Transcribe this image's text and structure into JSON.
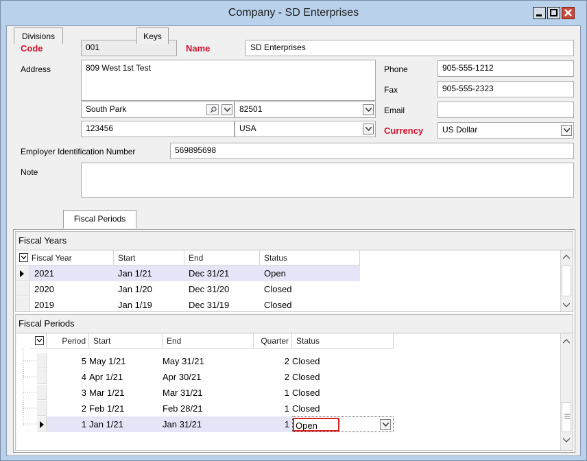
{
  "window": {
    "title": "Company - SD Enterprises"
  },
  "form": {
    "code_label": "Code",
    "code_value": "001",
    "name_label": "Name",
    "name_value": "SD Enterprises",
    "address_label": "Address",
    "address_value": "809 West 1st Test",
    "city_value": "South Park",
    "postal_value": "82501",
    "zip_value": "123456",
    "country_value": "USA",
    "phone_label": "Phone",
    "phone_value": "905-555-1212",
    "fax_label": "Fax",
    "fax_value": "905-555-2323",
    "email_label": "Email",
    "email_value": "",
    "currency_label": "Currency",
    "currency_value": "US Dollar",
    "ein_label": "Employer Identification Number",
    "ein_value": "569895698",
    "note_label": "Note",
    "note_value": ""
  },
  "tabs": [
    {
      "label": "Divisions"
    },
    {
      "label": "Fiscal Periods",
      "active": true
    },
    {
      "label": "Keys"
    }
  ],
  "fiscal_years": {
    "title": "Fiscal Years",
    "columns": [
      "Fiscal Year",
      "Start",
      "End",
      "Status"
    ],
    "rows": [
      {
        "year": "2021",
        "start": "Jan 1/21",
        "end": "Dec 31/21",
        "status": "Open",
        "selected": true
      },
      {
        "year": "2020",
        "start": "Jan 1/20",
        "end": "Dec 31/20",
        "status": "Closed"
      },
      {
        "year": "2019",
        "start": "Jan 1/19",
        "end": "Dec 31/19",
        "status": "Closed"
      }
    ]
  },
  "fiscal_periods": {
    "title": "Fiscal Periods",
    "columns": [
      "Period",
      "Start",
      "End",
      "Quarter",
      "Status"
    ],
    "rows": [
      {
        "period": "5",
        "start": "May 1/21",
        "end": "May 31/21",
        "quarter": "2",
        "status": "Closed"
      },
      {
        "period": "4",
        "start": "Apr 1/21",
        "end": "Apr 30/21",
        "quarter": "2",
        "status": "Closed"
      },
      {
        "period": "3",
        "start": "Mar 1/21",
        "end": "Mar 31/21",
        "quarter": "1",
        "status": "Closed"
      },
      {
        "period": "2",
        "start": "Feb 1/21",
        "end": "Feb 28/21",
        "quarter": "1",
        "status": "Closed"
      },
      {
        "period": "1",
        "start": "Jan 1/21",
        "end": "Jan 31/21",
        "quarter": "1",
        "status": "Open",
        "selected": true
      }
    ]
  },
  "colors": {
    "required": "#d4122e",
    "selected_row": "#e6e4f7",
    "edit_border": "#e02020"
  }
}
